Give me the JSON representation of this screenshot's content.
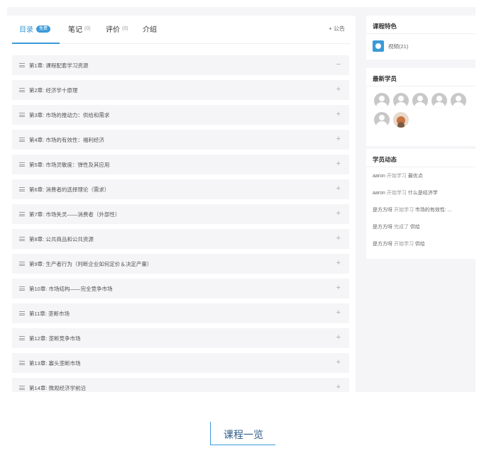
{
  "tabs": [
    {
      "label": "目录",
      "badge": "免费"
    },
    {
      "label": "笔记",
      "count": "(0)"
    },
    {
      "label": "评价",
      "count": "(0)"
    },
    {
      "label": "介绍"
    }
  ],
  "notice": "+ 公告",
  "chapters": [
    {
      "title": "第1章: 课程配套学习资源",
      "toggle": "−"
    },
    {
      "title": "第2章: 经济学十原理",
      "toggle": "+"
    },
    {
      "title": "第3章: 市场的推动力：供给和需求",
      "toggle": "+"
    },
    {
      "title": "第4章: 市场的有效性：福利经济",
      "toggle": "+"
    },
    {
      "title": "第5章: 市场灵敏度：弹性及其应用",
      "toggle": "+"
    },
    {
      "title": "第6章: 消费者的选择理论（需求）",
      "toggle": "+"
    },
    {
      "title": "第7章: 市场失灵——消费者（外部性）",
      "toggle": "+"
    },
    {
      "title": "第8章: 公共商品和公共资源",
      "toggle": "+"
    },
    {
      "title": "第9章: 生产者行为（判断企业如何定价＆决定产量）",
      "toggle": "+"
    },
    {
      "title": "第10章: 市场结构——完全竞争市场",
      "toggle": "+"
    },
    {
      "title": "第11章: 垄断市场",
      "toggle": "+"
    },
    {
      "title": "第12章: 垄断竞争市场",
      "toggle": "+"
    },
    {
      "title": "第13章: 寡头垄断市场",
      "toggle": "+"
    },
    {
      "title": "第14章: 微观经济学前沿",
      "toggle": "+"
    }
  ],
  "features": {
    "title": "课程特色",
    "items": [
      {
        "label": "视频(21)",
        "icon": "video-icon"
      }
    ]
  },
  "students": {
    "title": "最新学员",
    "count": 7
  },
  "activity": {
    "title": "学员动态",
    "items": [
      {
        "user": "aaron",
        "verb": "开始学习",
        "target": "最优点"
      },
      {
        "user": "aaron",
        "verb": "开始学习",
        "target": "什么是经济学"
      },
      {
        "user": "是方方呀",
        "verb": "开始学习",
        "target": "市场的有效性: ..."
      },
      {
        "user": "是方方呀",
        "verb": "完成了",
        "target": "供给"
      },
      {
        "user": "是方方呀",
        "verb": "开始学习",
        "target": "供给"
      }
    ]
  },
  "caption": "课程一览",
  "colors": {
    "accent": "#3a9ad9",
    "caption": "#2e5b87"
  }
}
